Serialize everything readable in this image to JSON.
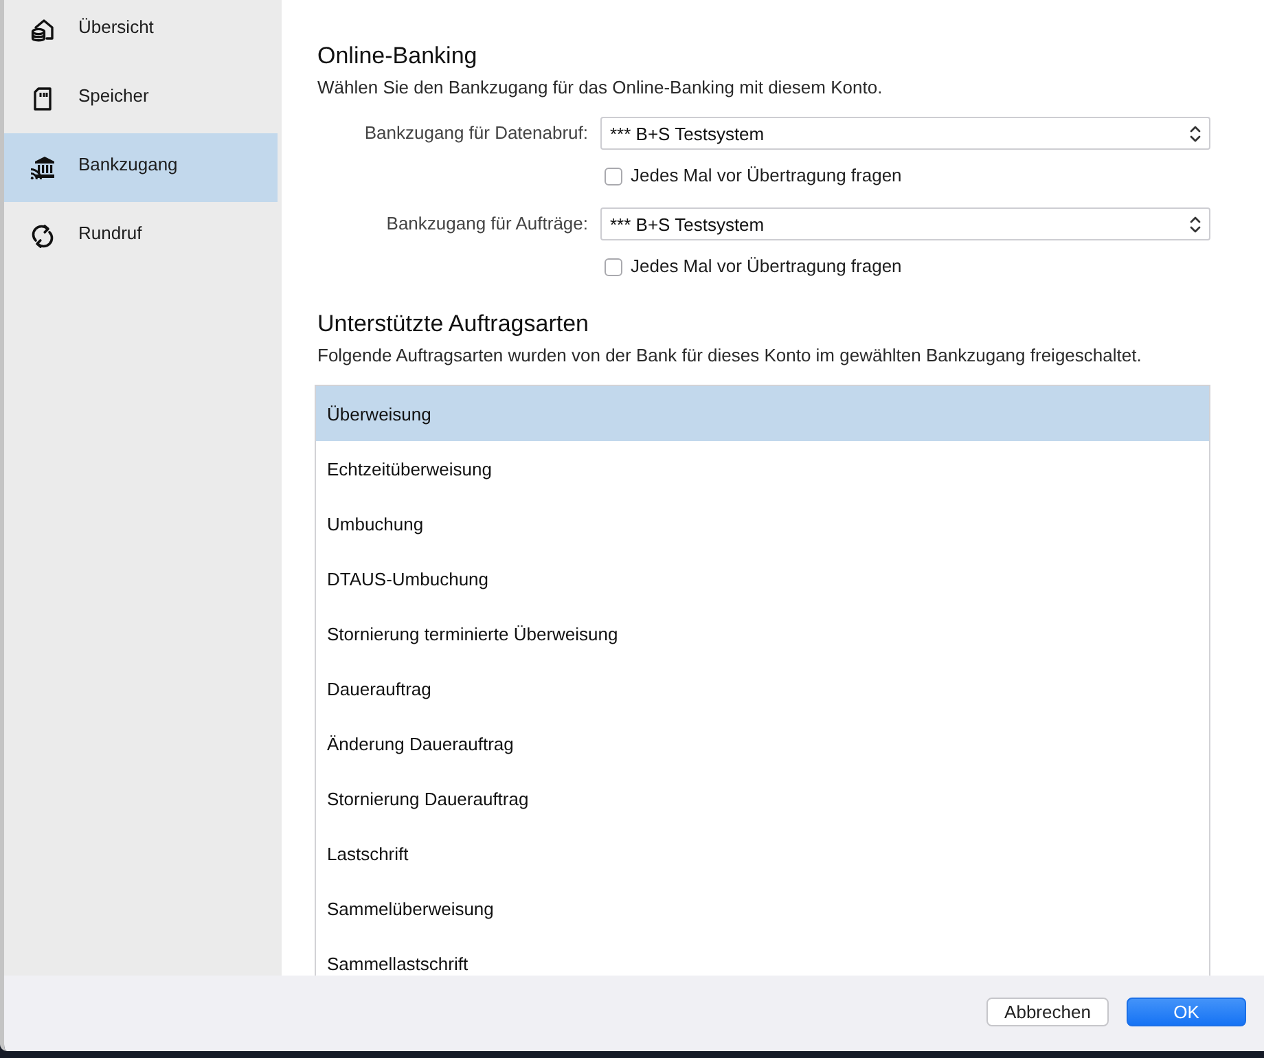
{
  "sidebar": {
    "items": [
      {
        "label": "Übersicht",
        "selected": false
      },
      {
        "label": "Speicher",
        "selected": false
      },
      {
        "label": "Bankzugang",
        "selected": true
      },
      {
        "label": "Rundruf",
        "selected": false
      }
    ]
  },
  "online_banking": {
    "title": "Online-Banking",
    "description": "Wählen Sie den Bankzugang für das Online-Banking mit diesem Konto.",
    "fields": [
      {
        "label": "Bankzugang für Datenabruf:",
        "value": "*** B+S Testsystem",
        "checkbox": {
          "label": "Jedes Mal vor Übertragung fragen",
          "checked": false
        }
      },
      {
        "label": "Bankzugang für Aufträge:",
        "value": "*** B+S Testsystem",
        "checkbox": {
          "label": "Jedes Mal vor Übertragung fragen",
          "checked": false
        }
      }
    ]
  },
  "order_types": {
    "title": "Unterstützte Auftragsarten",
    "description": "Folgende Auftragsarten wurden von der Bank für dieses Konto im gewählten Bankzugang freigeschaltet.",
    "items": [
      {
        "label": "Überweisung",
        "selected": true
      },
      {
        "label": "Echtzeitüberweisung",
        "selected": false
      },
      {
        "label": "Umbuchung",
        "selected": false
      },
      {
        "label": "DTAUS-Umbuchung",
        "selected": false
      },
      {
        "label": "Stornierung terminierte Überweisung",
        "selected": false
      },
      {
        "label": "Dauerauftrag",
        "selected": false
      },
      {
        "label": "Änderung Dauerauftrag",
        "selected": false
      },
      {
        "label": "Stornierung Dauerauftrag",
        "selected": false
      },
      {
        "label": "Lastschrift",
        "selected": false
      },
      {
        "label": "Sammelüberweisung",
        "selected": false
      },
      {
        "label": "Sammellastschrift",
        "selected": false
      }
    ]
  },
  "buttons": [
    {
      "label": "Abbrechen",
      "kind": "secondary"
    },
    {
      "label": "OK",
      "kind": "primary"
    }
  ]
}
